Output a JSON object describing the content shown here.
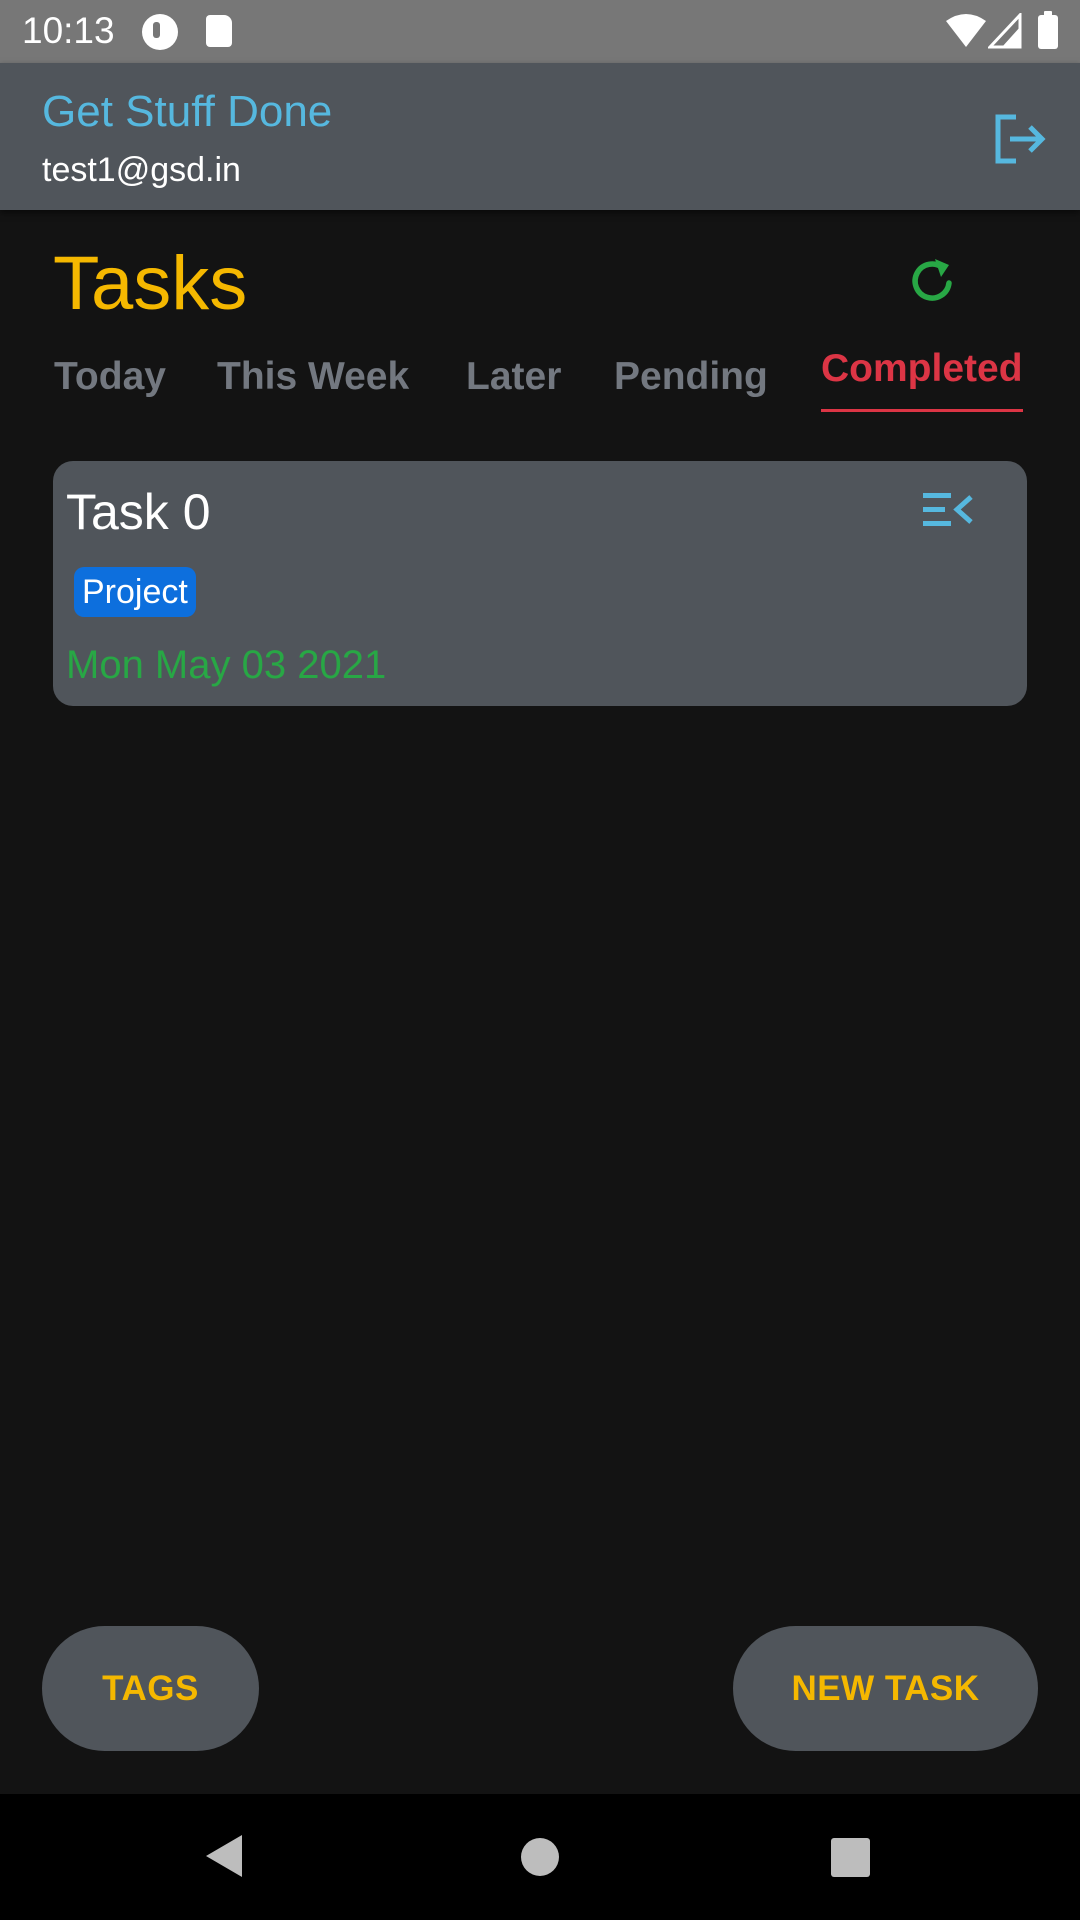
{
  "status_bar": {
    "time": "10:13",
    "icons": [
      "app-notification-icon",
      "sd-card-icon",
      "wifi-icon",
      "cell-signal-icon",
      "battery-icon"
    ]
  },
  "header": {
    "title": "Get Stuff Done",
    "email": "test1@gsd.in",
    "logout_icon": "logout-icon"
  },
  "page": {
    "title": "Tasks",
    "refresh_icon": "refresh-icon"
  },
  "tabs": [
    {
      "label": "Today",
      "active": false
    },
    {
      "label": "This Week",
      "active": false
    },
    {
      "label": "Later",
      "active": false
    },
    {
      "label": "Pending",
      "active": false
    },
    {
      "label": "Completed",
      "active": true
    }
  ],
  "tasks": [
    {
      "title": "Task 0",
      "tag": "Project",
      "date": "Mon May 03 2021",
      "menu_icon": "menu-collapse-icon"
    }
  ],
  "buttons": {
    "tags": "TAGS",
    "new_task": "NEW TASK"
  },
  "colors": {
    "accent_blue": "#56b8df",
    "title_yellow": "#f5b800",
    "active_tab_red": "#dc3545",
    "date_green": "#28a745",
    "tag_blue": "#0d6fdd",
    "card_gray": "#50555b",
    "background": "#131313"
  },
  "nav_bar": {
    "icons": [
      "back-icon",
      "home-icon",
      "recents-icon"
    ]
  }
}
